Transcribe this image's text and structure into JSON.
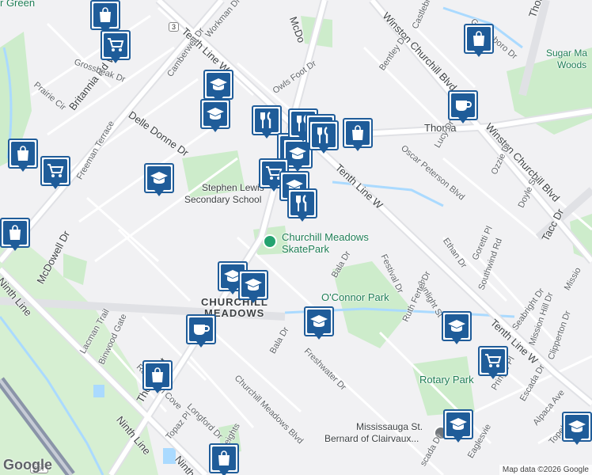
{
  "map": {
    "attribution": "Map data ©2026 Google",
    "logo": "Google",
    "area_name_1": "CHURCHILL",
    "area_name_2": "MEADOWS",
    "highway_shield_1": "3",
    "highway_shield_2": "407",
    "corner_place": "r Green",
    "park_sugar_1": "Sugar Ma",
    "park_sugar_2": "Woods",
    "school_name_1": "Stephen Lewis",
    "school_name_2": "Secondary School",
    "skatepark_1": "Churchill Meadows",
    "skatepark_2": "SkatePark",
    "oconnor_park": "O'Connor Park",
    "rotary_park": "Rotary Park",
    "mississauga_1": "Mississauga St.",
    "mississauga_2": "Bernard of Clairvaux..."
  },
  "streets": {
    "tenth_line_top": "Tenth Line W",
    "tenth_line_mid": "Tenth Line W",
    "tenth_line_bot": "Tenth Line W",
    "ninth_line_left": "Ninth Line",
    "ninth_line_bottom": "Ninth Line",
    "ninth_line_corner": "Ninth L",
    "winston_1": "Winston Churchill Blvd",
    "winston_2": "Winston Churchill Blvd",
    "thomas_top": "Thoma",
    "thomas_right": "Thomas",
    "thomas_left": "Thomas St",
    "britannia": "Britannia Rd W",
    "mcdowell": "McDowell Dr",
    "mcdo_top": "McDo",
    "delle_donne": "Delle Donne Dr",
    "freeman": "Freeman Terrace",
    "grossbeak": "Grossbeak Dr",
    "prairie": "Prairie Cir",
    "camberwell": "Camberwell Dr",
    "workman": "Workman Dr",
    "owls_foot": "Owls Foot Dr",
    "bentley": "Bentley Dr",
    "castlebridge": "Castlebr",
    "greensboro": "Greensboro Dr",
    "oscar": "Oscar Peterson Blvd",
    "lucy": "Lucy Dr",
    "ozzie": "Ozzie Dr",
    "doyle": "Doyle St",
    "tacc": "Tacc Dr",
    "ethan": "Ethan Dr",
    "goretti": "Goretti Pl",
    "southwind": "Southwind Rd",
    "festival": "Festival Dr",
    "sunlight": "Sunlight St",
    "ruth_fertel": "Ruth Fertel Dr",
    "bala_1": "Bala Dr",
    "bala_2": "Bala Dr",
    "freshwater": "Freshwater Dr",
    "churchill_meadows_blvd": "Churchill Meadows Blvd",
    "lacman": "Lacman Trail",
    "binwood": "Binwood Gate",
    "raftsman": "Raftsman Cove",
    "longford": "Longford Dr",
    "topaz": "Topaz Pl",
    "heights": "Heights",
    "seabright": "Seabright Dr",
    "mission_hill": "Mission Hill Dr",
    "clipperton": "Clipperton Dr",
    "pringle": "Pringle Pl",
    "escada": "Escada Dr",
    "escada_2": "scada Dr",
    "alpaca": "Alpaca Ave",
    "topeka": "Topeka",
    "eaglesview": "Eaglesvie",
    "missio_edge": "Missio"
  },
  "markers": [
    {
      "type": "shopping-bag",
      "label": "shopping"
    },
    {
      "type": "shopping-cart",
      "label": "grocery"
    },
    {
      "type": "shopping-bag",
      "label": "shopping"
    },
    {
      "type": "shopping-cart",
      "label": "grocery"
    },
    {
      "type": "school",
      "label": "school"
    },
    {
      "type": "school",
      "label": "school"
    },
    {
      "type": "school",
      "label": "school"
    },
    {
      "type": "shopping-bag",
      "label": "shopping"
    },
    {
      "type": "coffee",
      "label": "cafe"
    },
    {
      "type": "shopping-bag",
      "label": "shopping"
    },
    {
      "type": "restaurant",
      "label": "restaurant"
    },
    {
      "type": "school",
      "label": "school"
    },
    {
      "type": "school",
      "label": "school"
    },
    {
      "type": "coffee",
      "label": "cafe"
    },
    {
      "type": "shopping-bag",
      "label": "shopping"
    },
    {
      "type": "school",
      "label": "school"
    },
    {
      "type": "school",
      "label": "school"
    },
    {
      "type": "shopping-cart",
      "label": "grocery"
    },
    {
      "type": "school",
      "label": "school"
    },
    {
      "type": "school",
      "label": "school"
    },
    {
      "type": "shopping-bag",
      "label": "shopping"
    },
    {
      "type": "shopping-cart",
      "label": "grocery"
    },
    {
      "type": "restaurant",
      "label": "restaurant"
    },
    {
      "type": "restaurant",
      "label": "restaurant"
    },
    {
      "type": "restaurant",
      "label": "restaurant"
    },
    {
      "type": "shopping-bag",
      "label": "shopping"
    },
    {
      "type": "school",
      "label": "school"
    },
    {
      "type": "school",
      "label": "school"
    },
    {
      "type": "school",
      "label": "school"
    },
    {
      "type": "restaurant",
      "label": "restaurant"
    }
  ],
  "colors": {
    "background": "#f1f1f3",
    "road": "#ffffff",
    "major_road": "#e2e3e7",
    "park": "#cdeccb",
    "water": "#aadaff",
    "marker": "#1f5c99",
    "highway": "#8a94a8"
  }
}
